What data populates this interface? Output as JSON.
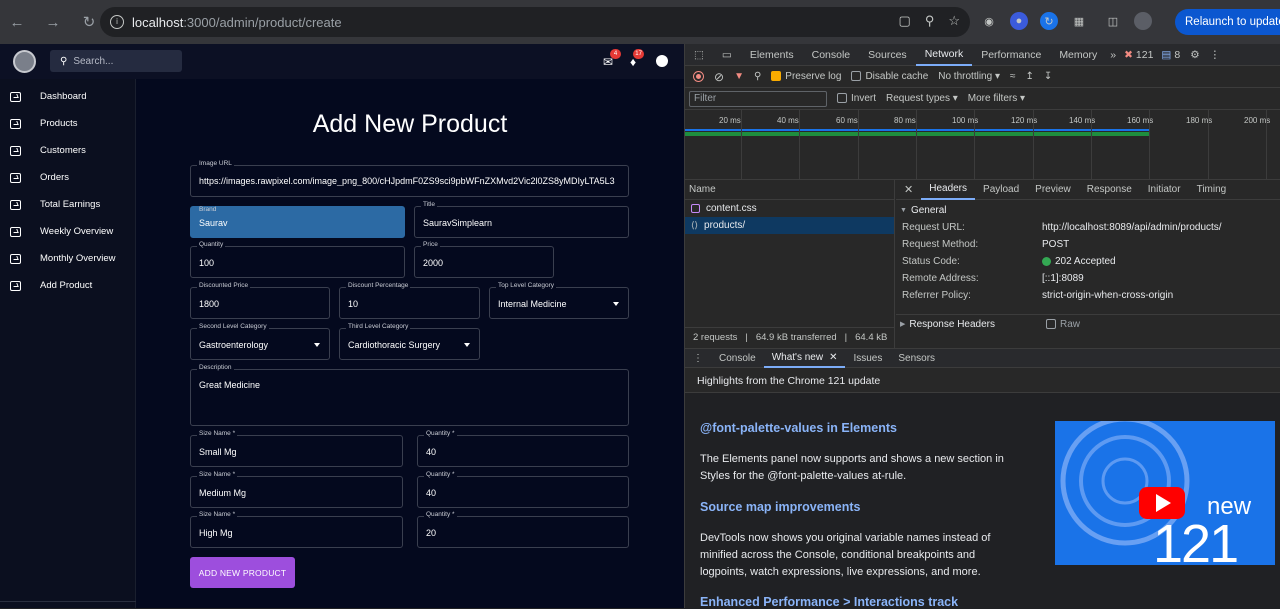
{
  "browser": {
    "url_host": "localhost",
    "url_path": ":3000/admin/product/create",
    "relaunch_label": "Relaunch to update"
  },
  "app": {
    "search_placeholder": "Search...",
    "mail_badge": "4",
    "bell_badge": "17",
    "sidebar": [
      {
        "label": "Dashboard"
      },
      {
        "label": "Products"
      },
      {
        "label": "Customers"
      },
      {
        "label": "Orders"
      },
      {
        "label": "Total Earnings"
      },
      {
        "label": "Weekly Overview"
      },
      {
        "label": "Monthly Overview"
      },
      {
        "label": "Add Product"
      }
    ],
    "form": {
      "title": "Add New Product",
      "image_url": {
        "label": "Image URL",
        "value": "https://images.rawpixel.com/image_png_800/cHJpdmF0ZS9sci9pbWFnZXMvd2Vic2l0ZS8yMDIyLTA5L3"
      },
      "brand": {
        "label": "Brand",
        "value": "Saurav"
      },
      "title_field": {
        "label": "Title",
        "value": "SauravSimplearn"
      },
      "quantity": {
        "label": "Quantity",
        "value": "100"
      },
      "price": {
        "label": "Price",
        "value": "2000"
      },
      "discounted_price": {
        "label": "Discounted Price",
        "value": "1800"
      },
      "discount_percentage": {
        "label": "Discount Percentage",
        "value": "10"
      },
      "top_category": {
        "label": "Top Level Category",
        "value": "Internal Medicine"
      },
      "second_category": {
        "label": "Second Level Category",
        "value": "Gastroenterology"
      },
      "third_category": {
        "label": "Third Level Category",
        "value": "Cardiothoracic Surgery"
      },
      "description": {
        "label": "Description",
        "value": "Great Medicine"
      },
      "sizes": [
        {
          "size_label": "Size Name *",
          "size": "Small Mg",
          "qty_label": "Quantity *",
          "qty": "40"
        },
        {
          "size_label": "Size Name *",
          "size": "Medium Mg",
          "qty_label": "Quantity *",
          "qty": "40"
        },
        {
          "size_label": "Size Name *",
          "size": "High Mg",
          "qty_label": "Quantity *",
          "qty": "20"
        }
      ],
      "submit_label": "ADD NEW PRODUCT"
    }
  },
  "devtools": {
    "tabs": [
      "Elements",
      "Console",
      "Sources",
      "Network",
      "Performance",
      "Memory"
    ],
    "errors_count": "121",
    "messages_count": "8",
    "preserve_log": "Preserve log",
    "disable_cache": "Disable cache",
    "throttling": "No throttling",
    "filter_placeholder": "Filter",
    "invert": "Invert",
    "request_types": "Request types",
    "more_filters": "More filters",
    "timeline_ticks": [
      "20 ms",
      "40 ms",
      "60 ms",
      "80 ms",
      "100 ms",
      "120 ms",
      "140 ms",
      "160 ms",
      "180 ms",
      "200 ms"
    ],
    "name_header": "Name",
    "requests": [
      {
        "name": "content.css"
      },
      {
        "name": "products/"
      }
    ],
    "status_requests": "2 requests",
    "status_transferred": "64.9 kB transferred",
    "status_resources": "64.4 kB",
    "header_tabs": [
      "Headers",
      "Payload",
      "Preview",
      "Response",
      "Initiator",
      "Timing"
    ],
    "general_label": "General",
    "general": [
      {
        "key": "Request URL:",
        "value": "http://localhost:8089/api/admin/products/"
      },
      {
        "key": "Request Method:",
        "value": "POST"
      },
      {
        "key": "Status Code:",
        "value": "202 Accepted"
      },
      {
        "key": "Remote Address:",
        "value": "[::1]:8089"
      },
      {
        "key": "Referrer Policy:",
        "value": "strict-origin-when-cross-origin"
      }
    ],
    "response_headers_label": "Response Headers",
    "raw_label": "Raw",
    "drawer_tabs": [
      "Console",
      "What's new",
      "Issues",
      "Sensors"
    ],
    "highlights": "Highlights from the Chrome 121 update",
    "whats_new": {
      "h1": "@font-palette-values in Elements",
      "p1": "The Elements panel now supports and shows a new section in Styles for the @font-palette-values at-rule.",
      "h2": "Source map improvements",
      "p2": "DevTools now shows you original variable names instead of minified across the Console, conditional breakpoints and logpoints, watch expressions, live expressions, and more.",
      "h3": "Enhanced Performance > Interactions track",
      "promo_new": "new",
      "promo_version": "121"
    }
  }
}
